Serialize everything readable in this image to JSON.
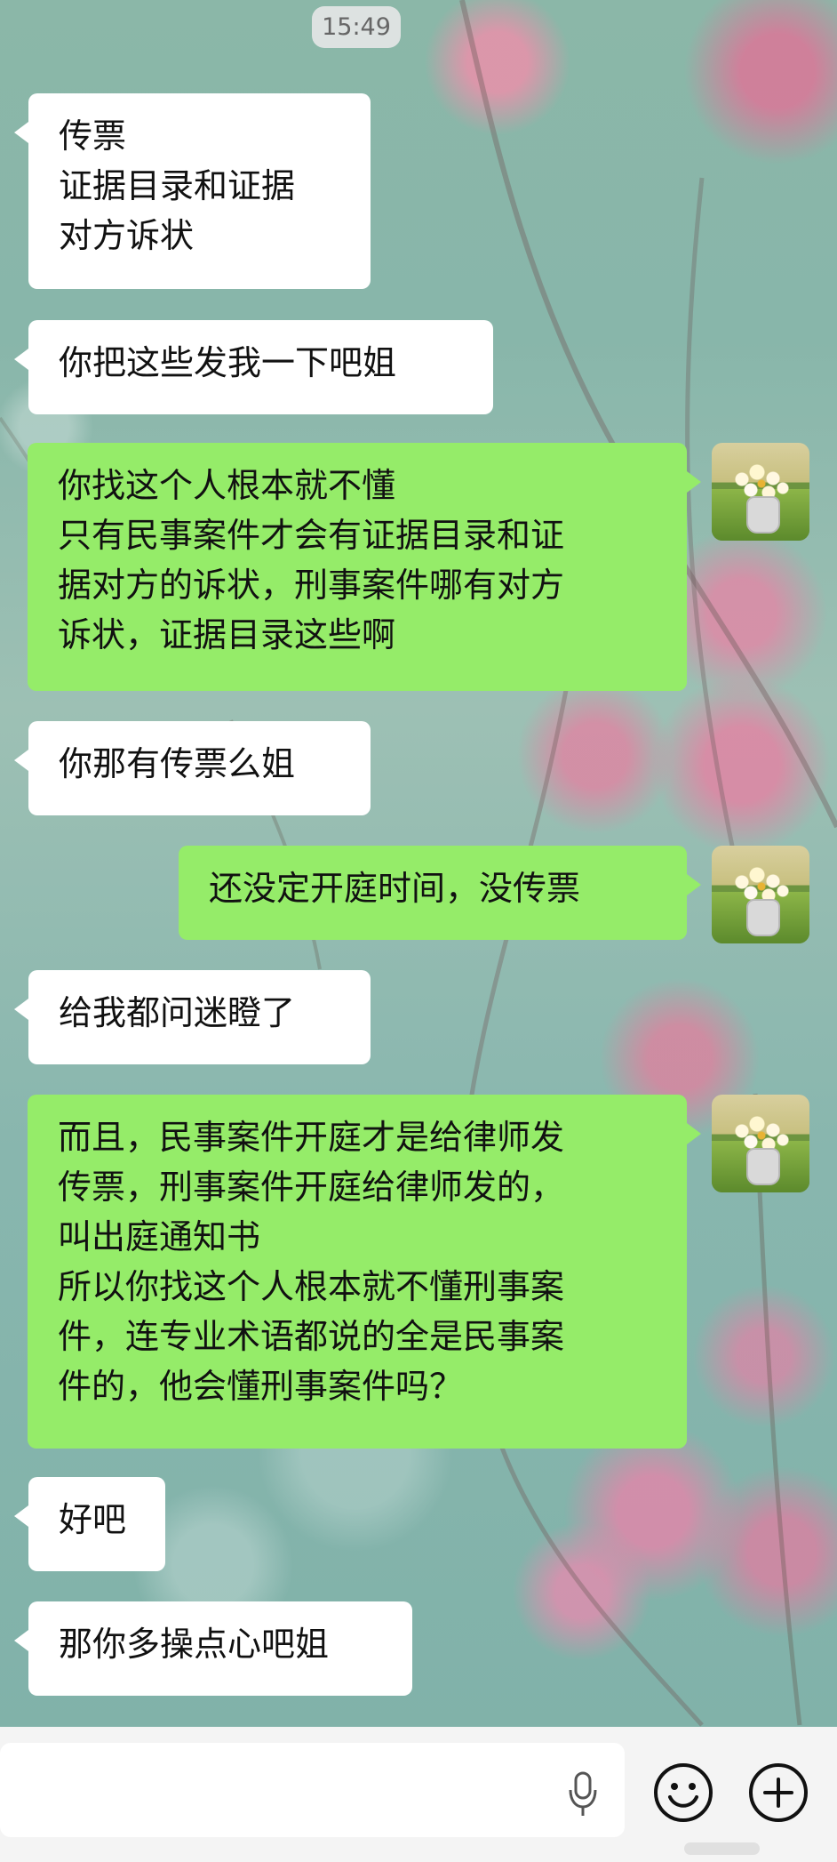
{
  "status": {
    "time": "15:49"
  },
  "colors": {
    "bubble_left": "#ffffff",
    "bubble_right": "#95ec69",
    "input_bar": "#f4f4f4"
  },
  "messages": [
    {
      "side": "left",
      "text": "传票\n证据目录和证据\n对方诉状"
    },
    {
      "side": "left",
      "text": "你把这些发我一下吧姐"
    },
    {
      "side": "right",
      "text": "你找这个人根本就不懂\n只有民事案件才会有证据目录和证\n据对方的诉状，刑事案件哪有对方\n诉状，证据目录这些啊"
    },
    {
      "side": "left",
      "text": "你那有传票么姐"
    },
    {
      "side": "right",
      "text": "还没定开庭时间，没传票"
    },
    {
      "side": "left",
      "text": "给我都问迷瞪了"
    },
    {
      "side": "right",
      "text": "而且，民事案件开庭才是给律师发\n传票，刑事案件开庭给律师发的，\n叫出庭通知书\n所以你找这个人根本就不懂刑事案\n件，连专业术语都说的全是民事案\n件的，他会懂刑事案件吗？"
    },
    {
      "side": "left",
      "text": "好吧"
    },
    {
      "side": "left",
      "text": "那你多操点心吧姐"
    }
  ],
  "avatar": {
    "icon": "flower-vase-avatar-icon"
  },
  "input": {
    "text": "",
    "mic_icon": "microphone-icon",
    "emoji_icon": "smile-face-icon",
    "more_icon": "plus-circle-icon"
  }
}
